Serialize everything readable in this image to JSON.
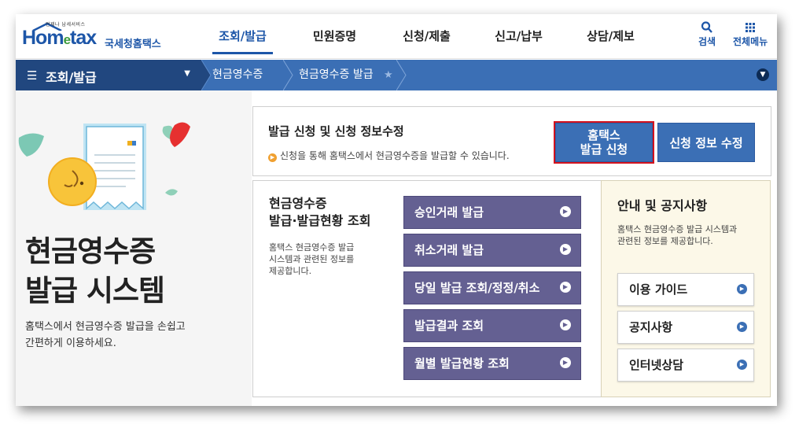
{
  "header": {
    "logo_small": "언제나 납세서비스",
    "logo_main_a": "Hom",
    "logo_main_e": "e",
    "logo_main_b": "tax",
    "logo_sub": "국세청홈택스",
    "menu": [
      "조회/발급",
      "민원증명",
      "신청/제출",
      "신고/납부",
      "상담/제보"
    ],
    "search_label": "검색",
    "allmenu_label": "전체메뉴"
  },
  "navbar": {
    "menu_label": "조회/발급",
    "crumbs": [
      "현금영수증",
      "현금영수증 발급"
    ]
  },
  "hero": {
    "title_line1": "현금영수증",
    "title_line2": "발급 시스템",
    "desc_line1": "홈택스에서 현금영수증 발급을 손쉽고",
    "desc_line2": "간편하게 이용하세요."
  },
  "apply_panel": {
    "title": "발급 신청 및 신청 정보수정",
    "desc": "신청을 통해 홈택스에서 현금영수증을 발급할 수 있습니다.",
    "issue_btn_line1": "홈택스",
    "issue_btn_line2": "발급 신청",
    "edit_btn": "신청 정보 수정"
  },
  "issue_panel": {
    "title_line1": "현금영수증",
    "title_line2": "발급·발급현황 조회",
    "desc_line1": "홈택스 현금영수증 발급",
    "desc_line2": "시스템과 관련된 정보를",
    "desc_line3": "제공합니다.",
    "buttons": [
      "승인거래 발급",
      "취소거래 발급",
      "당일 발급 조회/정정/취소",
      "발급결과 조회",
      "월별 발급현황 조회"
    ]
  },
  "notice_panel": {
    "title": "안내 및 공지사항",
    "desc_line1": "홈택스 현금영수증 발급 시스템과",
    "desc_line2": "관련된 정보를 제공합니다.",
    "buttons": [
      "이용 가이드",
      "공지사항",
      "인터넷상담"
    ]
  },
  "colors": {
    "primary": "#3b6fb5",
    "navy": "#21477f",
    "purple": "#646092",
    "highlight_red": "#d3121e",
    "notice_bg": "#fcf8e8"
  }
}
